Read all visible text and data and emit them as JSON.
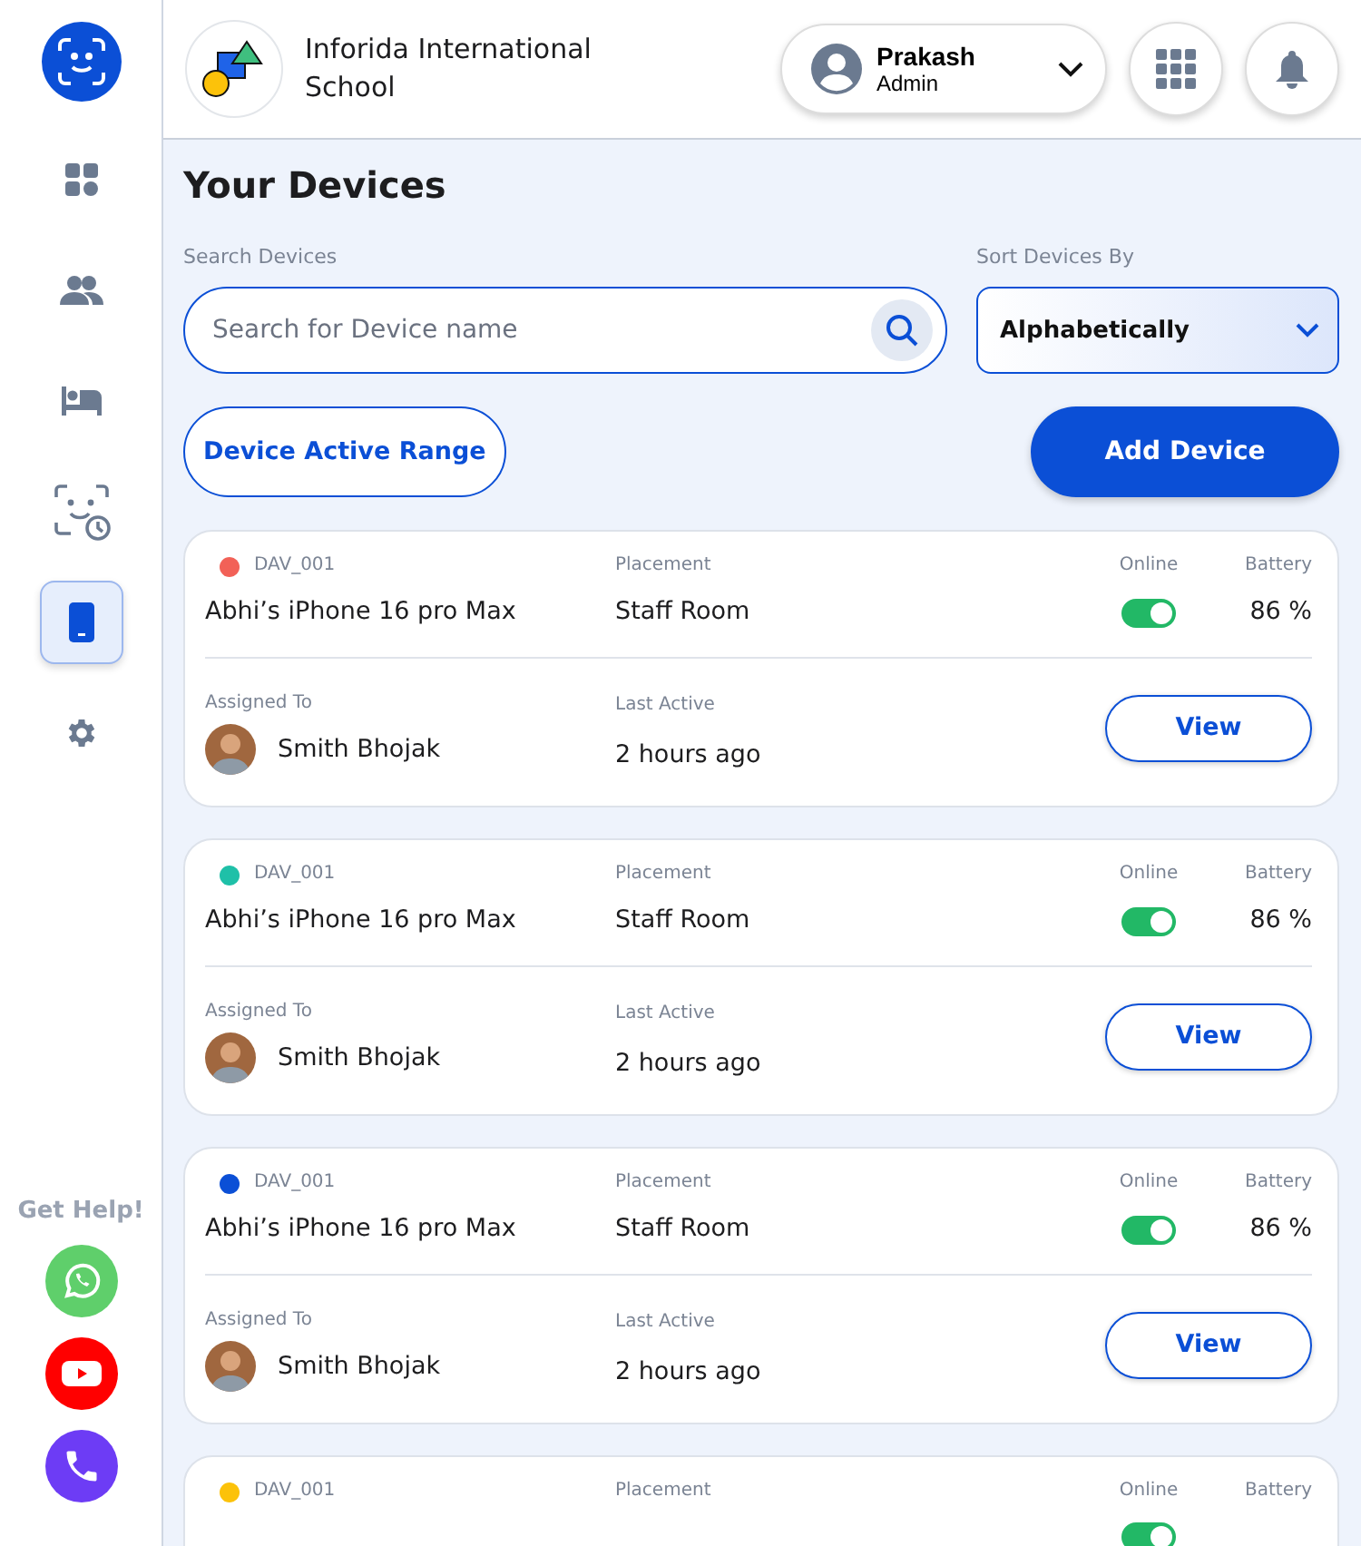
{
  "sidebar": {
    "nav": [
      {
        "kind": "dashboard",
        "selected": false
      },
      {
        "kind": "people",
        "selected": false
      },
      {
        "kind": "bed",
        "selected": false
      },
      {
        "kind": "face-clock",
        "selected": false
      },
      {
        "kind": "phone",
        "selected": true
      },
      {
        "kind": "settings",
        "selected": false
      }
    ],
    "help_title": "Get Help!",
    "help": [
      {
        "kind": "chat"
      },
      {
        "kind": "video"
      },
      {
        "kind": "call"
      }
    ]
  },
  "header": {
    "school": "Inforida International School",
    "user": {
      "name": "Prakash",
      "role": "Admin"
    }
  },
  "title": "Your Devices",
  "search": {
    "label": "Search Devices",
    "placeholder": "Search for Device name"
  },
  "sort": {
    "label": "Sort Devices By",
    "value": "Alphabetically"
  },
  "range_button": "Device Active Range",
  "add_button": "Add Device",
  "devices": [
    {
      "id": "DAV_001",
      "color": "#f26157",
      "placement_label": "Placement",
      "name": "Abhi’s iPhone 16 pro Max",
      "placement": "Staff Room",
      "online_label": "Online",
      "online": true,
      "battery_label": "Battery",
      "battery": "86 %",
      "assigned_label": "Assigned To",
      "assigned_to": "Smith Bhojak",
      "last_active_label": "Last Active",
      "last_active": "2 hours ago",
      "button": "View"
    },
    {
      "id": "DAV_001",
      "color": "#1fc0a8",
      "placement_label": "Placement",
      "name": "Abhi’s iPhone 16 pro Max",
      "placement": "Staff Room",
      "online_label": "Online",
      "online": true,
      "battery_label": "Battery",
      "battery": "86 %",
      "assigned_label": "Assigned To",
      "assigned_to": "Smith Bhojak",
      "last_active_label": "Last Active",
      "last_active": "2 hours ago",
      "button": "View"
    },
    {
      "id": "DAV_001",
      "color": "#0b4fd6",
      "placement_label": "Placement",
      "name": "Abhi’s iPhone 16 pro Max",
      "placement": "Staff Room",
      "online_label": "Online",
      "online": true,
      "battery_label": "Battery",
      "battery": "86 %",
      "assigned_label": "Assigned To",
      "assigned_to": "Smith Bhojak",
      "last_active_label": "Last Active",
      "last_active": "2 hours ago",
      "button": "View"
    },
    {
      "id": "DAV_001",
      "color": "#fcc20a",
      "placement_label": "Placement",
      "online_label": "Online",
      "online": true,
      "battery_label": "Battery"
    }
  ]
}
